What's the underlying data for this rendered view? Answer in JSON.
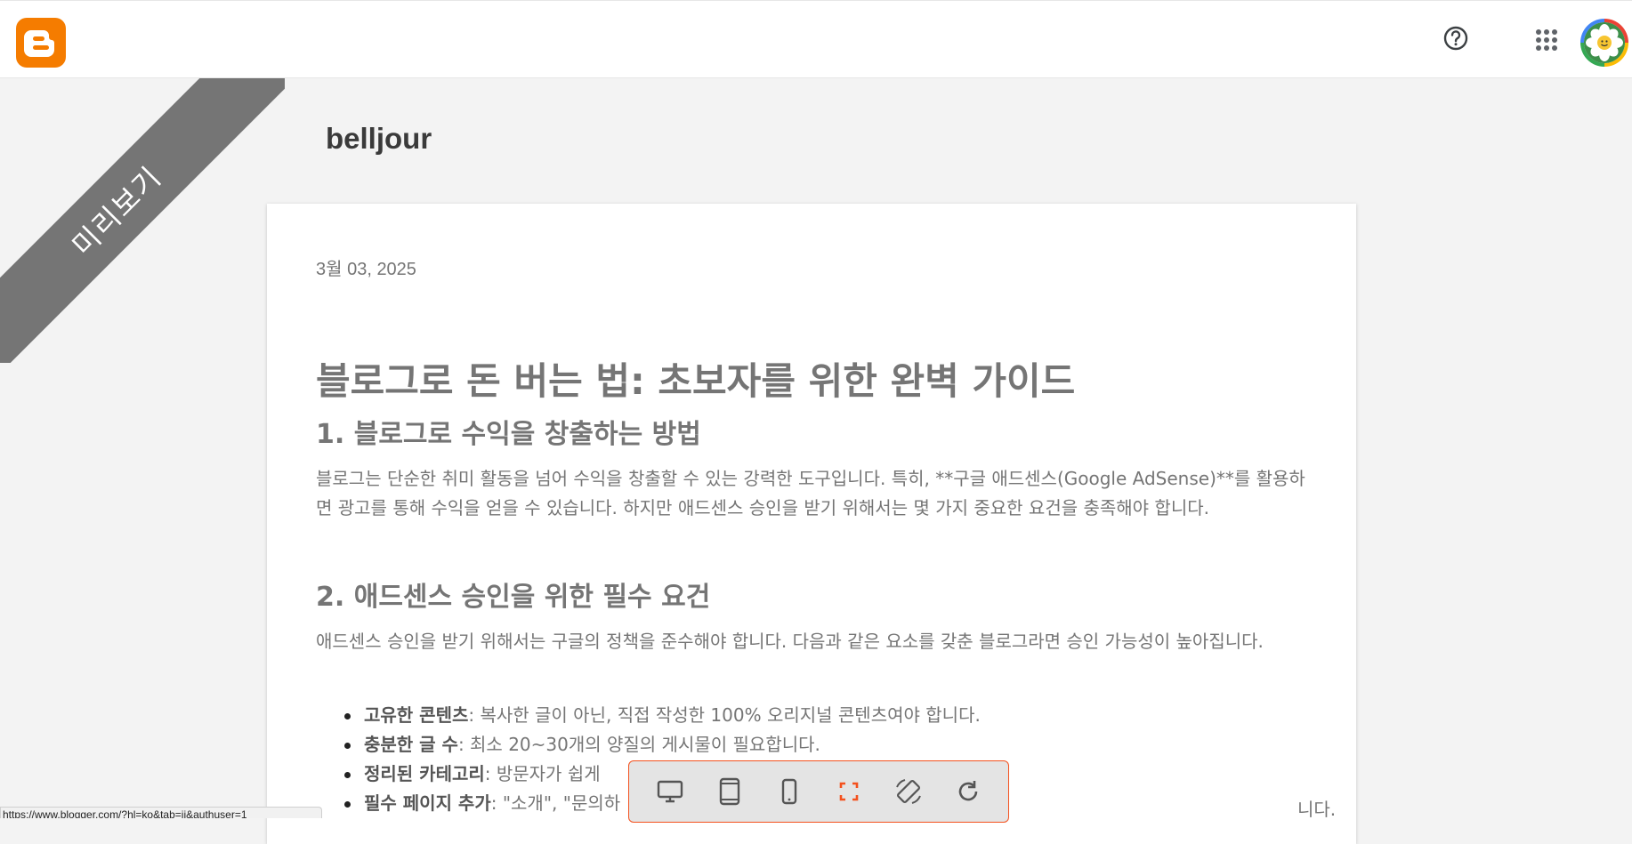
{
  "app": {
    "logo_icon": "blogger-logo-icon"
  },
  "header": {
    "help_icon": "help-circle-icon",
    "apps_icon": "apps-grid-icon",
    "avatar_icon": "avatar-flower-icon"
  },
  "preview": {
    "ribbon_label": "미리보기"
  },
  "blog": {
    "title": "belljour"
  },
  "post": {
    "date": "3월 03, 2025",
    "title": "블로그로 돈 버는 법: 초보자를 위한 완벽 가이드",
    "sections": [
      {
        "heading": "1. 블로그로 수익을 창출하는 방법",
        "paragraph": "블로그는 단순한 취미 활동을 넘어 수익을 창출할 수 있는 강력한 도구입니다. 특히, **구글 애드센스(Google AdSense)**를 활용하면 광고를 통해 수익을 얻을 수 있습니다. 하지만 애드센스 승인을 받기 위해서는 몇 가지 중요한 요건을 충족해야 합니다."
      },
      {
        "heading": "2. 애드센스 승인을 위한 필수 요건",
        "paragraph": "애드센스 승인을 받기 위해서는 구글의 정책을 준수해야 합니다. 다음과 같은 요소를 갖춘 블로그라면 승인 가능성이 높아집니다."
      }
    ],
    "bullets": [
      {
        "bold": "고유한 콘텐츠",
        "text": ": 복사한 글이 아닌, 직접 작성한 100% 오리지널 콘텐츠여야 합니다."
      },
      {
        "bold": "충분한 글 수",
        "text": ": 최소 20~30개의 양질의 게시물이 필요합니다."
      },
      {
        "bold": "정리된 카테고리",
        "text": ": 방문자가 쉽게"
      },
      {
        "bold": "필수 페이지 추가",
        "text": ": \"소개\", \"문의하"
      }
    ],
    "bullet_tail_text": "니다."
  },
  "status_bar": {
    "url": "https://www.blogger.com/?hl=ko&tab=ji&authuser=1"
  },
  "device_toolbar": {
    "items": [
      "desktop-icon",
      "tablet-icon",
      "mobile-icon",
      "fullscreen-icon",
      "rotate-screen-icon",
      "refresh-icon"
    ],
    "accent_color": "#f4511e"
  },
  "colors": {
    "brand": "#f57c00",
    "ribbon": "#757575",
    "text": "#757575"
  }
}
